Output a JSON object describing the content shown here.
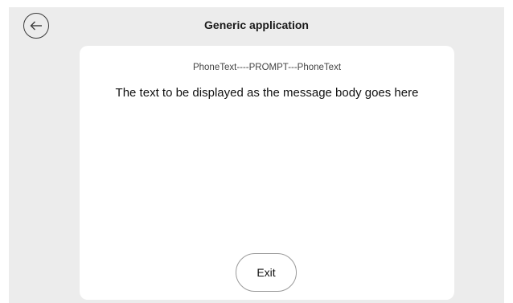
{
  "header": {
    "title": "Generic application",
    "back_icon": "arrow-left-icon"
  },
  "card": {
    "prompt": "PhoneText----PROMPT---PhoneText",
    "body": "The text to be displayed as the message body goes here",
    "exit_label": "Exit"
  },
  "colors": {
    "screen_background": "#ececec",
    "card_background": "#ffffff"
  }
}
